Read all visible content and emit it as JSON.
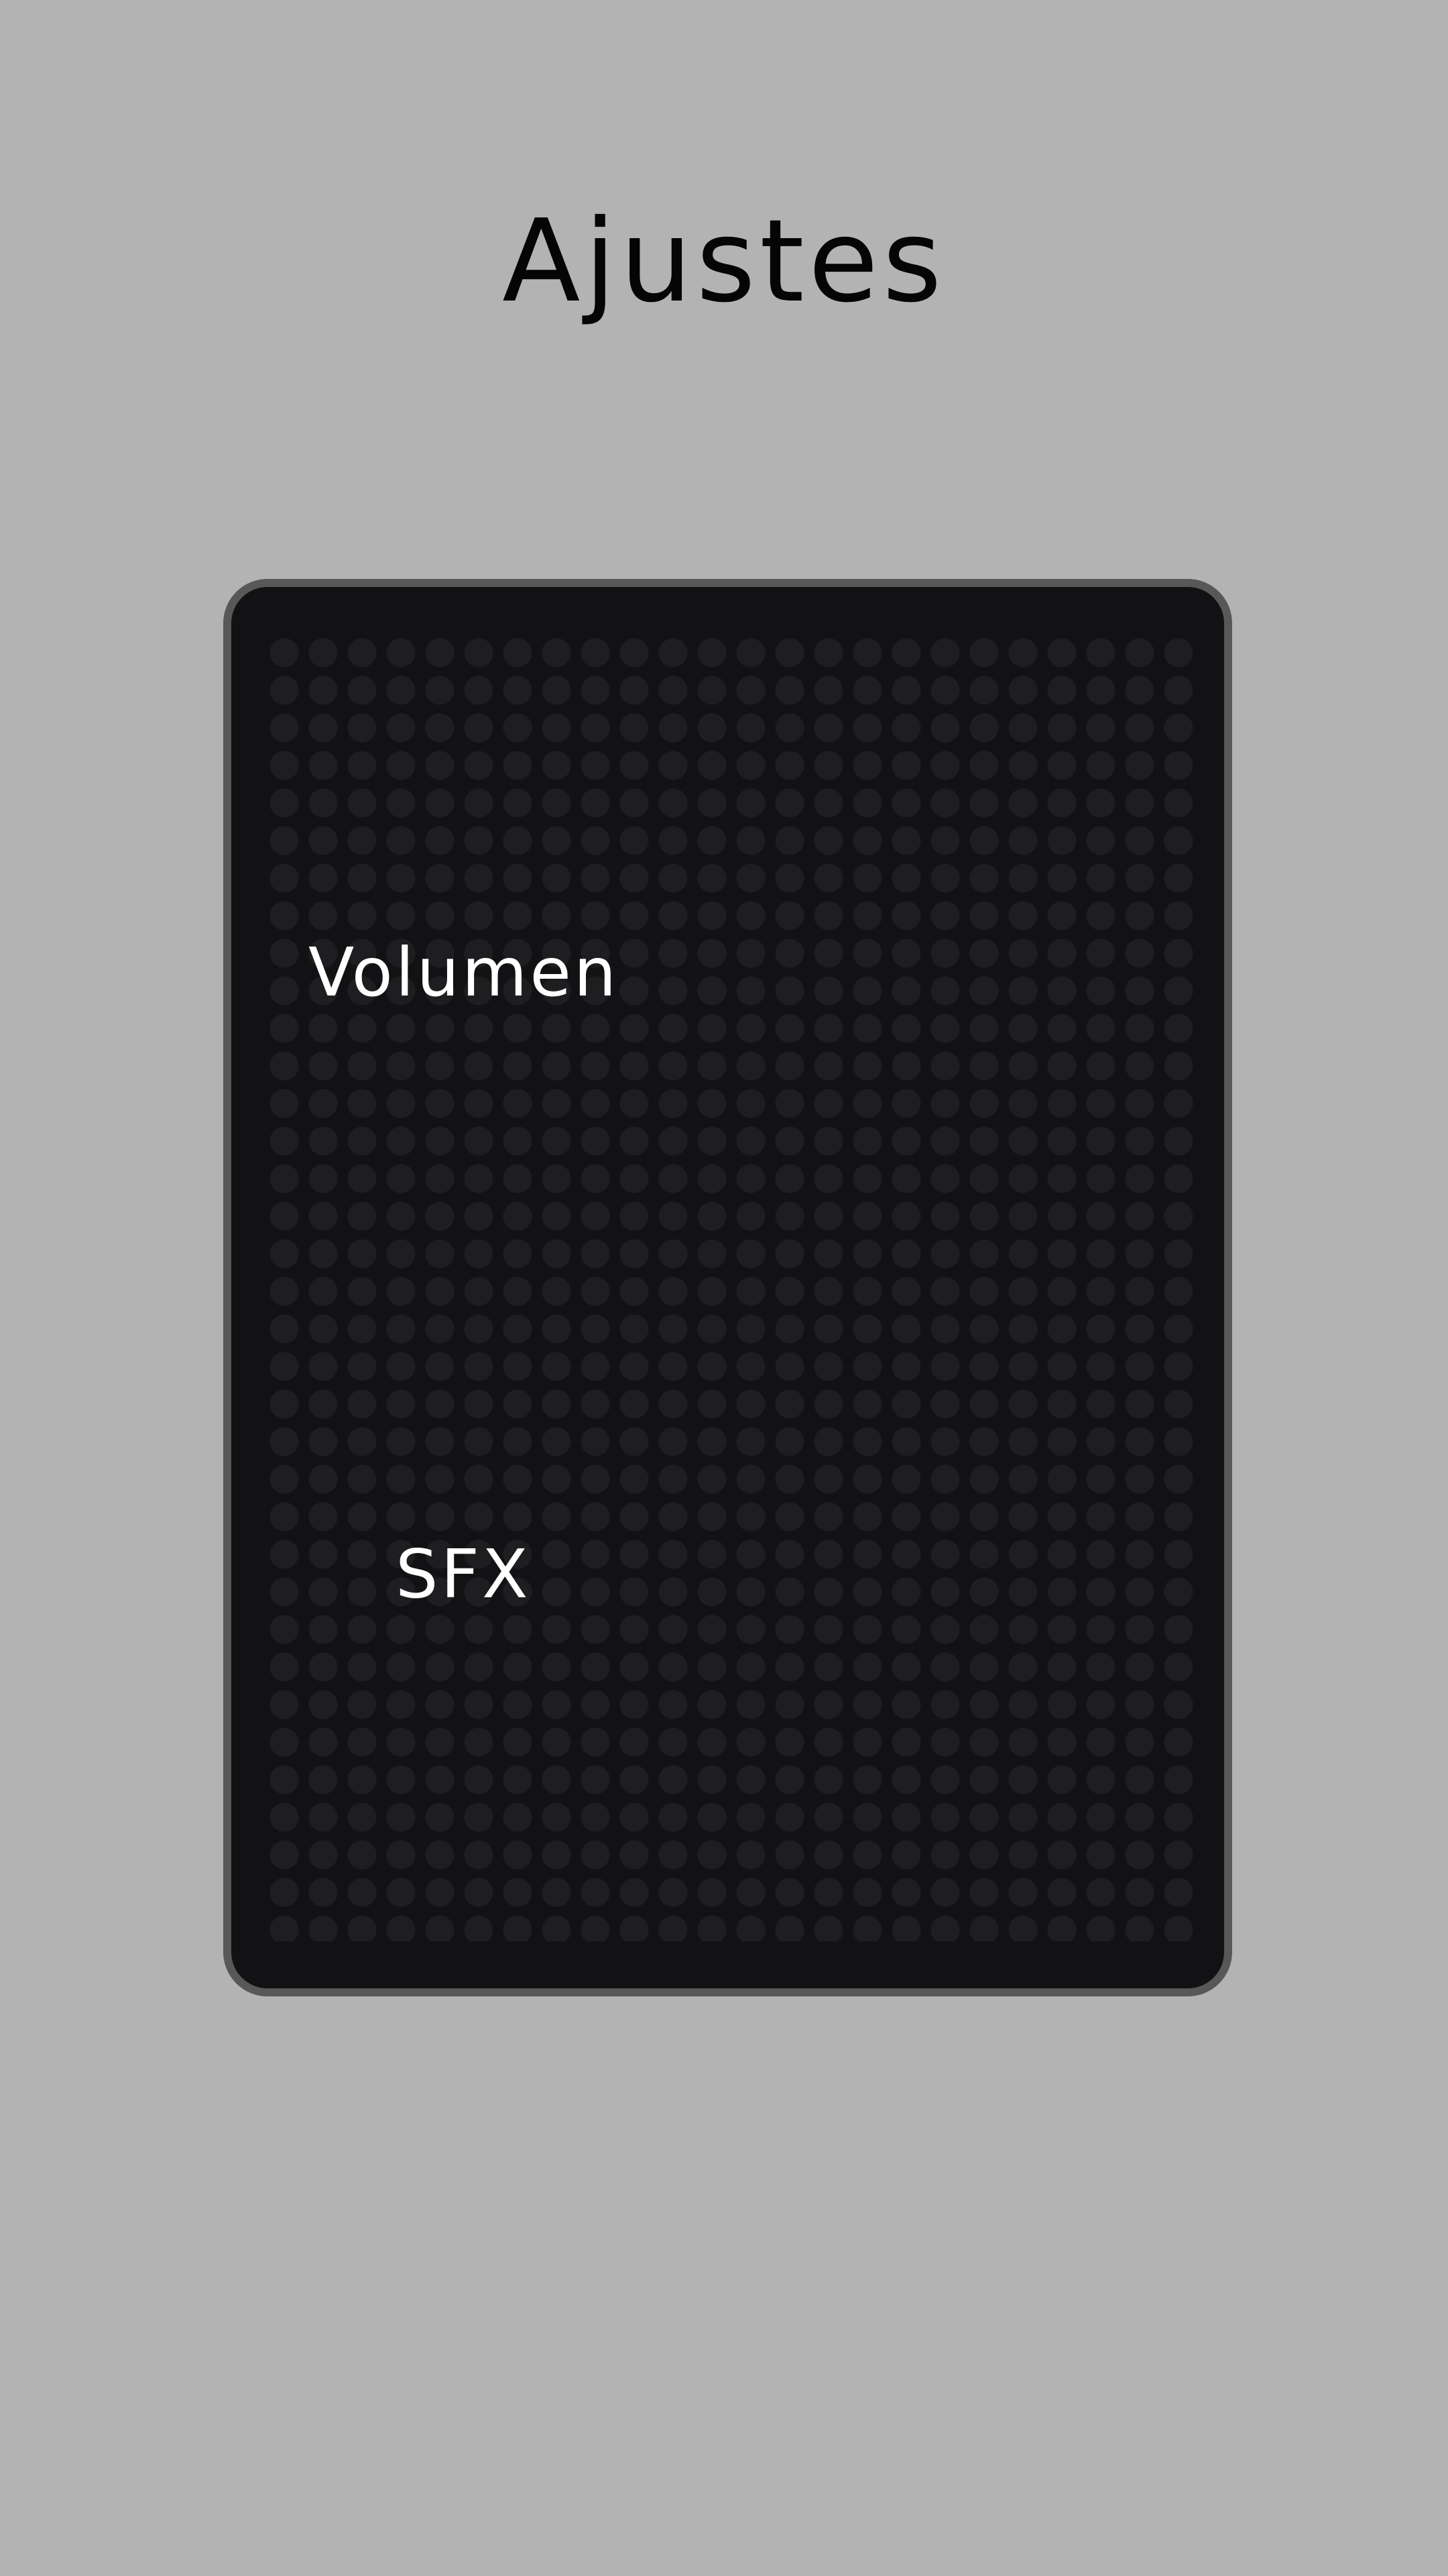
{
  "screen": {
    "title": "Ajustes"
  },
  "settings_panel": {
    "volume_label": "Volumen",
    "sfx_label": "SFX"
  },
  "colors": {
    "background": "#b3b3b3",
    "panel": "#121214",
    "panel_border": "#585858",
    "dots": "#1e1e20",
    "title_text": "#050505",
    "label_text": "#ffffff"
  }
}
